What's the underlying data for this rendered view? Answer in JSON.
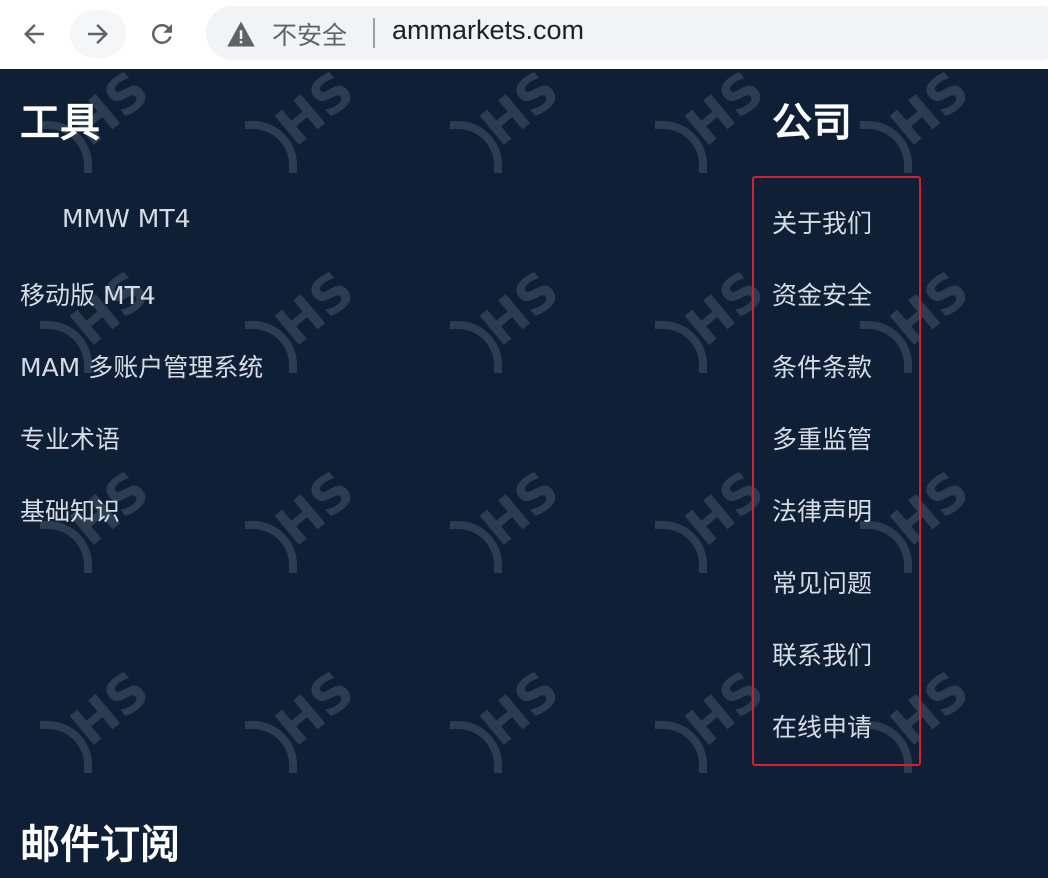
{
  "browser": {
    "security_label": "不安全",
    "url": "ammarkets.com"
  },
  "footer": {
    "tools": {
      "title": "工具",
      "links": [
        "MMW MT4",
        "移动版 MT4",
        "MAM 多账户管理系统",
        "专业术语",
        "基础知识"
      ]
    },
    "company": {
      "title": "公司",
      "links": [
        "关于我们",
        "资金安全",
        "条件条款",
        "多重监管",
        "法律声明",
        "常见问题",
        "联系我们",
        "在线申请"
      ]
    },
    "newsletter": {
      "title": "邮件订阅"
    }
  },
  "watermark": {
    "text": "HS"
  },
  "colors": {
    "background": "#0e1f36",
    "link": "#d6dce5",
    "annotation": "#d32030"
  }
}
